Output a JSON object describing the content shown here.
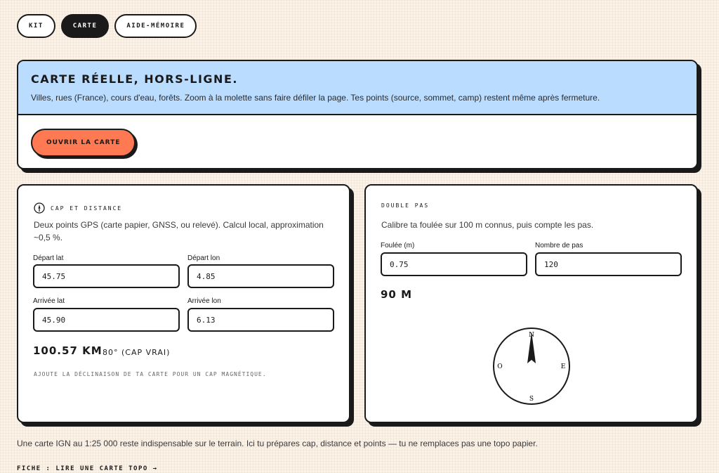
{
  "tabs": [
    {
      "label": "Kit"
    },
    {
      "label": "Carte"
    },
    {
      "label": "Aide-mémoire"
    }
  ],
  "hero": {
    "title": "Carte réelle, hors-ligne.",
    "description": "Villes, rues (France), cours d'eau, forêts. Zoom à la molette sans faire défiler la page. Tes points (source, sommet, camp) restent même après fermeture.",
    "button": "Ouvrir la carte",
    "button_color": "#ff7a52",
    "header_color": "#b9dcff"
  },
  "cap": {
    "title": "Cap et distance",
    "icon": "compass-icon",
    "description": "Deux points GPS (carte papier, GNSS, ou relevé). Calcul local, approximation ~0,5 %.",
    "start_lat_label": "Départ lat",
    "start_lat": "45.75",
    "start_lon_label": "Départ lon",
    "start_lon": "4.85",
    "end_lat_label": "Arrivée lat",
    "end_lat": "45.90",
    "end_lon_label": "Arrivée lon",
    "end_lon": "6.13",
    "distance": "100.57 km",
    "bearing": "80° (cap vrai)",
    "hint": "Ajoute la déclinaison de ta carte pour un cap magnétique."
  },
  "double_pas": {
    "title": "Double pas",
    "description": "Calibre ta foulée sur 100 m connus, puis compte les pas.",
    "stride_label": "Foulée (m)",
    "stride": "0.75",
    "steps_label": "Nombre de pas",
    "steps": "120",
    "result": "90 m",
    "compass": {
      "n": "N",
      "e": "E",
      "s": "S",
      "w": "O",
      "needle_heading_deg": 0
    }
  },
  "footer": {
    "note": "Une carte IGN au 1:25 000 reste indispensable sur le terrain. Ici tu prépares cap, distance et points — tu ne remplaces pas une topo papier.",
    "link": "Fiche : lire une carte topo →"
  }
}
